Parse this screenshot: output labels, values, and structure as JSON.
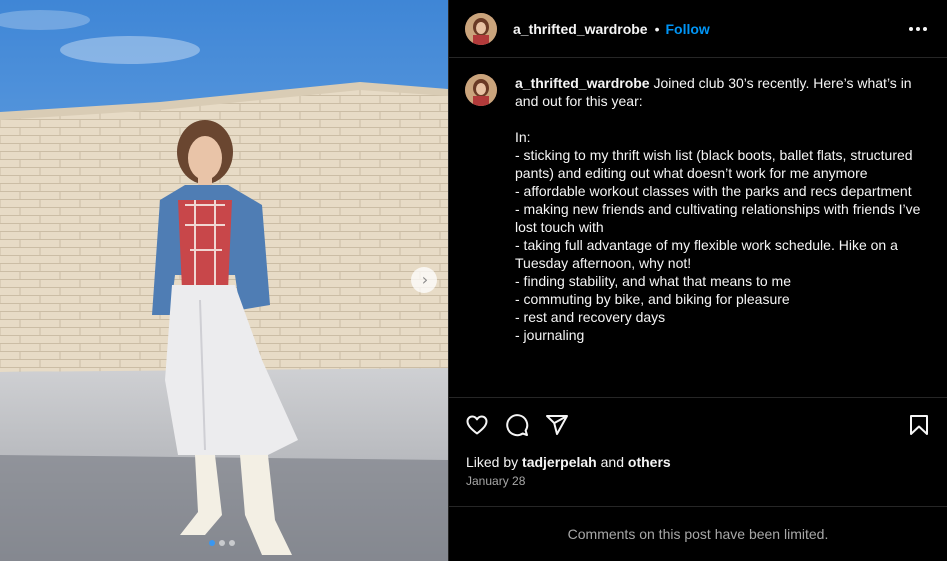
{
  "post": {
    "username": "a_thrifted_wardrobe",
    "separator": "•",
    "follow_label": "Follow",
    "caption": "Joined club 30’s recently. Here’s what’s in and out for this year:\n\nIn:\n- sticking to my thrift wish list (black boots, ballet flats, structured pants) and editing out what doesn’t work for me anymore\n- affordable workout classes with the parks and recs department\n- making new friends and cultivating relationships with friends I’ve lost touch with\n- taking full advantage of my flexible work schedule. Hike on a Tuesday afternoon, why not!\n- finding stability, and what that means to me\n- commuting by bike, and biking for pleasure\n- rest and recovery days\n- journaling",
    "liked_by_prefix": "Liked by",
    "liked_by_user": "tadjerpelah",
    "liked_by_and": "and",
    "liked_by_others": "others",
    "date": "January 28",
    "comments_limited": "Comments on this post have been limited."
  },
  "carousel": {
    "next_glyph": "›",
    "slide_count": 3,
    "active_index": 0
  },
  "icons": {
    "like": "heart-icon",
    "comment": "comment-icon",
    "share": "share-icon",
    "save": "bookmark-icon",
    "more": "more-options-icon",
    "next": "chevron-right-icon"
  },
  "colors": {
    "background": "#000000",
    "text": "#f5f5f5",
    "secondary_text": "#a8a8a8",
    "accent": "#0095f6",
    "border": "#262626"
  }
}
